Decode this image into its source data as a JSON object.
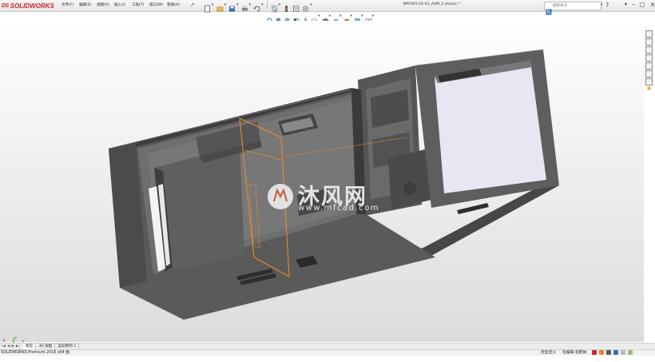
{
  "app": {
    "brand": "SOLIDWORKS",
    "brand_prefix": "DS"
  },
  "menu": {
    "items": [
      {
        "label": "文件(F)"
      },
      {
        "label": "编辑(E)"
      },
      {
        "label": "视图(V)"
      },
      {
        "label": "插入(I)"
      },
      {
        "label": "工具(T)"
      },
      {
        "label": "窗口(W)"
      },
      {
        "label": "帮助(H)"
      }
    ]
  },
  "document": {
    "title": "NPF065-01-01_ASM_2.sldasm *"
  },
  "search": {
    "placeholder": "搜索命令"
  },
  "watermark": {
    "text": "沐风网",
    "url": "www.mfcad.com"
  },
  "bottom_tabs": [
    {
      "label": "模型",
      "active": true
    },
    {
      "label": "3D 视图",
      "active": false
    },
    {
      "label": "运动算例 1",
      "active": false
    }
  ],
  "status": {
    "version": "SOLIDWORKS Premium 2016 x64 版",
    "mode": "完全定义",
    "editing": "在编辑 装配体"
  },
  "colors": {
    "accent": "#d2232a",
    "model_body": "#5c5c5c",
    "selection": "#e8892d",
    "background_top": "#ffffff",
    "background_bottom": "#dcdcdc"
  },
  "icons": {
    "quick_access": [
      "new-document-icon",
      "open-icon",
      "save-icon",
      "print-icon",
      "undo-icon",
      "select-icon",
      "rebuild-icon",
      "file-properties-icon",
      "options-icon"
    ],
    "heads_up": [
      "zoom-to-fit-icon",
      "zoom-area-icon",
      "previous-view-icon",
      "section-view-icon",
      "dynamic-annotation-icon",
      "view-orientation-icon",
      "display-style-icon",
      "hide-show-icon",
      "edit-appearance-icon",
      "apply-scene-icon",
      "view-settings-icon"
    ],
    "task_pane": [
      "solidworks-resources-icon",
      "design-library-icon",
      "file-explorer-icon",
      "view-palette-icon",
      "appearances-icon",
      "custom-properties-icon",
      "forum-icon"
    ]
  }
}
